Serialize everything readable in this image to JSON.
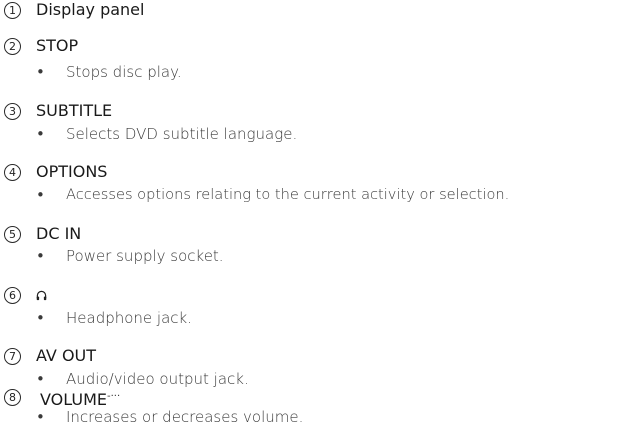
{
  "items": [
    {
      "number": "1",
      "title": "Display panel",
      "description": ""
    },
    {
      "number": "2",
      "title": "STOP",
      "bullet": "•",
      "description": "Stops disc play."
    },
    {
      "number": "3",
      "title": "SUBTITLE",
      "bullet": "•",
      "description": "Selects DVD subtitle language."
    },
    {
      "number": "4",
      "title": "OPTIONS",
      "bullet": "•",
      "description": "Accesses options relating to the current activity or selection."
    },
    {
      "number": "5",
      "title": "DC IN",
      "bullet": "•",
      "description": "Power supply socket."
    },
    {
      "number": "6",
      "title": "",
      "icon": "headphone-icon",
      "bullet": "•",
      "description": "Headphone jack."
    },
    {
      "number": "7",
      "title": "AV OUT",
      "bullet": "•",
      "description": "Audio/video output jack."
    },
    {
      "number": "8",
      "title": "VOLUME",
      "title_suffix": "-···",
      "bullet": "•",
      "description": "Increases or decreases volume."
    }
  ]
}
